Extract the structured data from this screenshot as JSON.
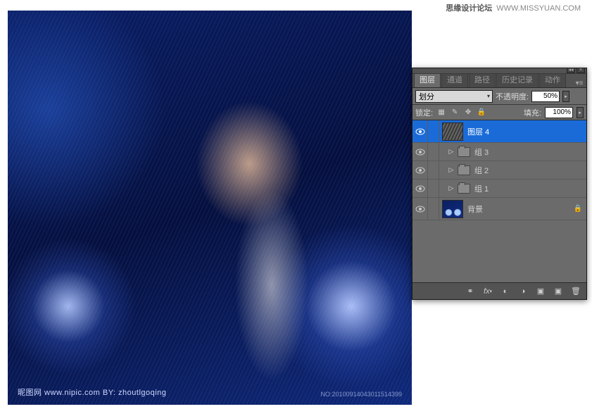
{
  "watermark": {
    "cn": "思缘设计论坛",
    "url": "WWW.MISSYUAN.COM"
  },
  "canvas": {
    "wm_left": "昵图网 www.nipic.com   BY: zhoutlgoqing",
    "wm_right": "NO:20100914043011514399"
  },
  "panel": {
    "tabs": [
      "图层",
      "通道",
      "路径",
      "历史记录",
      "动作"
    ],
    "active_tab": 0,
    "blend_mode": "划分",
    "opacity_label": "不透明度:",
    "opacity_value": "50%",
    "lock_label": "锁定:",
    "fill_label": "填充:",
    "fill_value": "100%",
    "layers": [
      {
        "name": "图层 4",
        "type": "layer",
        "selected": true,
        "visible": true,
        "thumb": "diag"
      },
      {
        "name": "组 3",
        "type": "group",
        "visible": true
      },
      {
        "name": "组 2",
        "type": "group",
        "visible": true
      },
      {
        "name": "组 1",
        "type": "group",
        "visible": true
      },
      {
        "name": "背景",
        "type": "layer",
        "visible": true,
        "locked": true,
        "thumb": "bg"
      }
    ],
    "footer_icons": [
      "link",
      "fx",
      "mask",
      "adjust",
      "group",
      "new",
      "trash"
    ]
  }
}
